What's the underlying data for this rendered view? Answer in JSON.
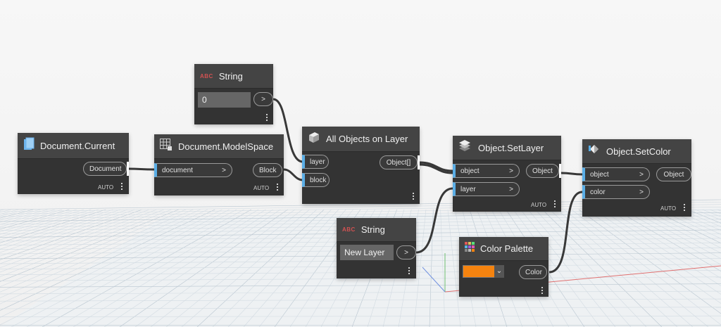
{
  "colors": {
    "node_bg": "#3a3a3a",
    "input_accent": "#5aaee6",
    "palette_swatch": "#f5830f",
    "wire": "#3a3a3a"
  },
  "nodes": {
    "string_top": {
      "title": "String",
      "icon_text": "ABC",
      "value": "0",
      "output": ">"
    },
    "doc_current": {
      "title": "Document.Current",
      "output": "Document",
      "auto": "AUTO"
    },
    "modelspace": {
      "title": "Document.ModelSpace",
      "input": "document",
      "input_chev": ">",
      "output": "Block",
      "auto": "AUTO"
    },
    "all_objects": {
      "title": "All Objects on Layer",
      "input_layer": "layer",
      "input_block": "block",
      "output": "Object[]"
    },
    "setlayer": {
      "title": "Object.SetLayer",
      "input_object": "object",
      "input_layer": "layer",
      "chev": ">",
      "output": "Object",
      "auto": "AUTO"
    },
    "setcolor": {
      "title": "Object.SetColor",
      "input_object": "object",
      "input_color": "color",
      "chev": ">",
      "output": "Object",
      "auto": "AUTO"
    },
    "string_bottom": {
      "title": "String",
      "icon_text": "ABC",
      "value": "New Layer",
      "output": ">"
    },
    "color_palette": {
      "title": "Color Palette",
      "output": "Color",
      "dropdown_icon": "chevron-down-icon"
    }
  }
}
